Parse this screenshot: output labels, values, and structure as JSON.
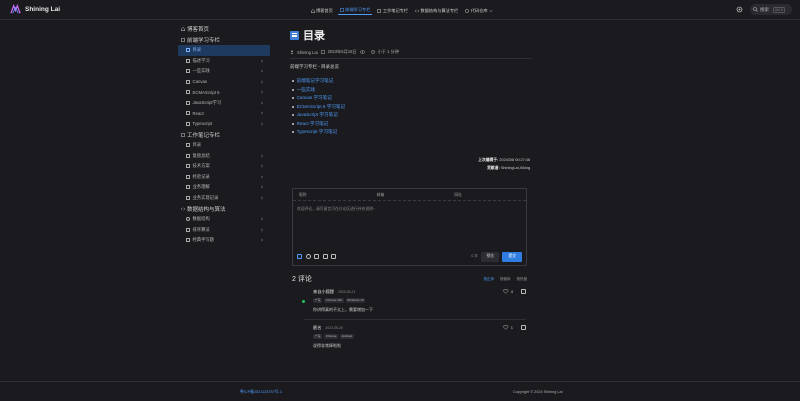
{
  "header": {
    "site_name": "Shining Lai",
    "menu": [
      {
        "label": "博客首页",
        "icon": "home-icon"
      },
      {
        "label": "前端学习专栏",
        "icon": "book-icon",
        "active": true
      },
      {
        "label": "工作笔记专栏",
        "icon": "note-icon"
      },
      {
        "label": "数据结构与算法专栏",
        "icon": "code-icon"
      },
      {
        "label": "代码仓库",
        "icon": "github-icon"
      }
    ],
    "search_label": "搜索",
    "search_shortcut": "Ctrl K"
  },
  "sidebar": {
    "home_label": "博客首页",
    "groups": [
      {
        "label": "前端学习专栏",
        "items": [
          {
            "label": "目录",
            "active": true
          },
          {
            "label": "描述学习"
          },
          {
            "label": "一些实践"
          },
          {
            "label": "Canvas"
          },
          {
            "label": "ECMAScript 6"
          },
          {
            "label": "JavaScript学习"
          },
          {
            "label": "React"
          },
          {
            "label": "Typescript"
          }
        ]
      },
      {
        "label": "工作笔记专栏",
        "items": [
          {
            "label": "目录"
          },
          {
            "label": "复盘总结"
          },
          {
            "label": "技术方案"
          },
          {
            "label": "经验记录"
          },
          {
            "label": "业务理解"
          },
          {
            "label": "业务实现记录"
          }
        ]
      },
      {
        "label": "数据结构与算法",
        "items": [
          {
            "label": "数据结构"
          },
          {
            "label": "排序算法"
          },
          {
            "label": "经典手写题"
          }
        ]
      }
    ]
  },
  "article": {
    "title": "目录",
    "author": "Shining Lai",
    "date": "2023年5月18日",
    "read_time": "小于 1 分钟",
    "description": "前端学习专栏 - 目录总览",
    "toc": [
      "前端笔记学习笔记",
      "一些实践",
      "Canvas 学习笔记",
      "ECMAScript 6 学习笔记",
      "JavaScript 学习笔记",
      "React 学习笔记",
      "Typescript 学习笔记"
    ],
    "last_updated_label": "上次编辑于:",
    "last_updated_value": "2024/3/8 00:27:46",
    "contributors_label": "贡献者:",
    "contributors_value": "ShiningLai,Xiking"
  },
  "comment_form": {
    "fields": [
      "昵称",
      "邮箱",
      "网址"
    ],
    "placeholder": "欢迎评论，请写留言可在讨论区进行补充说明~",
    "word_count": "0 字",
    "preview_label": "预览",
    "submit_label": "提交"
  },
  "comments": {
    "count_label": "2 评论",
    "sort": [
      "按正序",
      "按倒序",
      "按热度"
    ],
    "items": [
      {
        "name": "来自小狐狸",
        "date": "2023-05-21",
        "tags": [
          "广东",
          "Chrome 116",
          "Windows 10"
        ],
        "body": "你讲得真的不太上，需要增加一下",
        "likes": "4",
        "admin": true
      },
      {
        "name": "匿名",
        "date": "2023-05-25",
        "tags": [
          "广东",
          "Chrome",
          "Android"
        ],
        "body": "说得非常棒啦啦",
        "likes": "1",
        "admin": false
      }
    ]
  },
  "footer": {
    "icp": "粤ICP备2021123757号-1",
    "copyright": "Copyright © 2024 Shining Lai"
  },
  "colors": {
    "accent": "#4f9cf9",
    "background": "#1b1b1f",
    "submit": "#2f7de0"
  }
}
